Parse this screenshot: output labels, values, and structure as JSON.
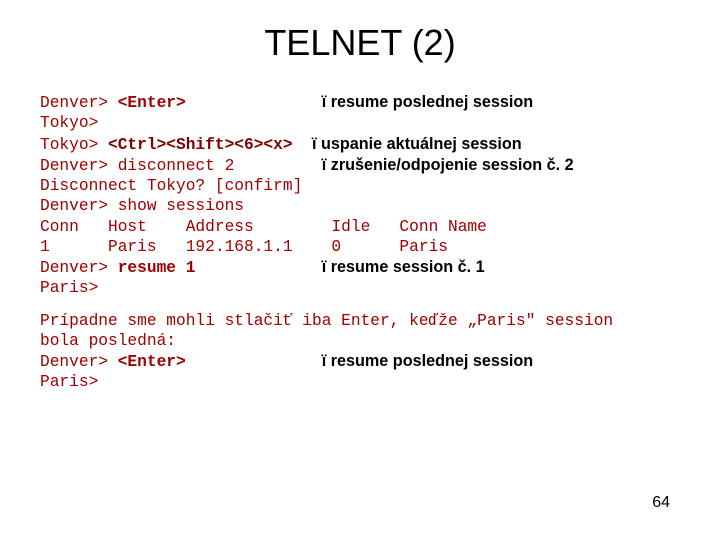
{
  "title": "TELNET (2)",
  "block1": {
    "l1a": "Denver> ",
    "l1b": "<Enter>",
    "l1note": "resume poslednej session",
    "l2": "Tokyo>",
    "l3a": "Tokyo> ",
    "l3b": "<Ctrl><Shift><6><x>",
    "l3note": "uspanie aktuálnej session",
    "l4": "Denver> disconnect 2",
    "l4note": "zrušenie/odpojenie session č. 2",
    "l5": "Disconnect Tokyo? [confirm]",
    "l6": "Denver> show sessions",
    "l7": "Conn   Host    Address        Idle   Conn Name",
    "l8": "1      Paris   192.168.1.1    0      Paris",
    "l9a": "Denver> ",
    "l9b": "resume 1",
    "l9note": "resume session č. 1",
    "l10": "Paris>"
  },
  "block2": {
    "intro1": "Prípadne sme mohli stlačiť iba Enter, keďže „Paris\" session",
    "intro2": "bola posledná:",
    "l1a": "Denver> ",
    "l1b": "<Enter>",
    "l1note": "resume poslednej session",
    "l2": "Paris>"
  },
  "arrow": "ï",
  "pagenum": "64"
}
